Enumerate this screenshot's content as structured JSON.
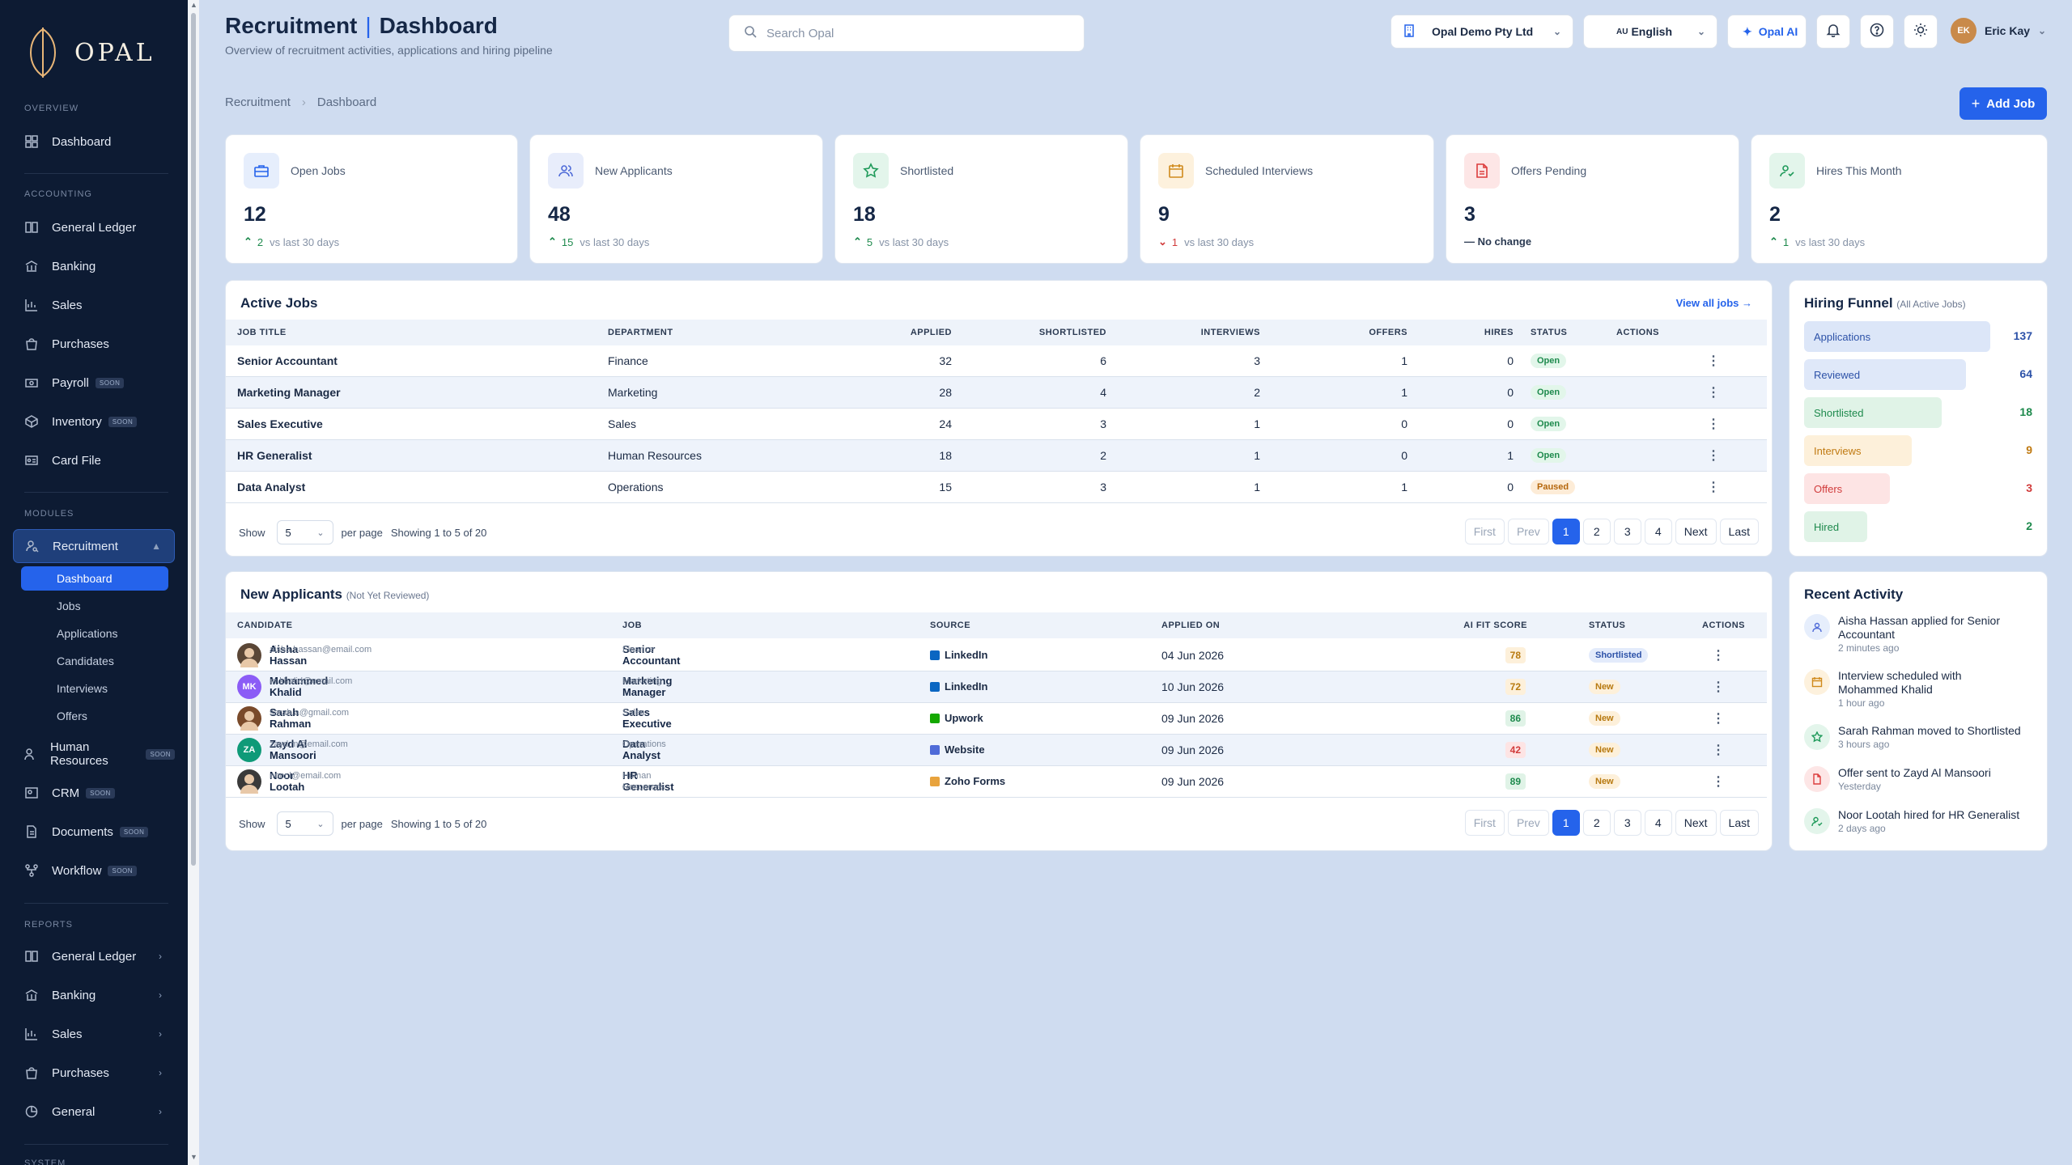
{
  "app": {
    "name": "OPAL"
  },
  "sidebar": {
    "overview_title": "OVERVIEW",
    "accounting_title": "ACCOUNTING",
    "modules_title": "MODULES",
    "reports_title": "REPORTS",
    "system_title": "SYSTEM",
    "soon": "SOON",
    "dashboard": "Dashboard",
    "accounting": [
      "General Ledger",
      "Banking",
      "Sales",
      "Purchases",
      "Payroll",
      "Inventory",
      "Card File"
    ],
    "recruitment": "Recruitment",
    "recruitment_sub": [
      "Dashboard",
      "Jobs",
      "Applications",
      "Candidates",
      "Interviews",
      "Offers"
    ],
    "modules": [
      "Human Resources",
      "CRM",
      "Documents",
      "Workflow"
    ],
    "reports": [
      "General Ledger",
      "Banking",
      "Sales",
      "Purchases",
      "General"
    ]
  },
  "header": {
    "title": "Recruitment",
    "title_sep": "|",
    "title_page": "Dashboard",
    "subtitle": "Overview of recruitment activities, applications and hiring pipeline",
    "search_placeholder": "Search Opal",
    "company": "Opal Demo Pty Ltd",
    "lang_code": "AU",
    "language": "English",
    "ai": "Opal AI",
    "user_initials": "EK",
    "user_name": "Eric Kay"
  },
  "breadcrumb": {
    "root": "Recruitment",
    "current": "Dashboard"
  },
  "add_job": "Add Job",
  "stats": [
    {
      "label": "Open Jobs",
      "value": "12",
      "delta": "2",
      "note": "vs last 30 days",
      "dir": "up",
      "color": "#2563eb",
      "bg": "#e6eefc"
    },
    {
      "label": "New Applicants",
      "value": "48",
      "delta": "15",
      "note": "vs last 30 days",
      "dir": "up",
      "color": "#4f6bd8",
      "bg": "#e8edfb"
    },
    {
      "label": "Shortlisted",
      "value": "18",
      "delta": "5",
      "note": "vs last 30 days",
      "dir": "up",
      "color": "#1f9a5a",
      "bg": "#e3f5eb"
    },
    {
      "label": "Scheduled Interviews",
      "value": "9",
      "delta": "1",
      "note": "vs last 30 days",
      "dir": "down",
      "color": "#d08a1c",
      "bg": "#fdf1dd"
    },
    {
      "label": "Offers Pending",
      "value": "3",
      "delta": "",
      "note": "— No change",
      "dir": "none",
      "color": "#dc3d3d",
      "bg": "#fde6e6"
    },
    {
      "label": "Hires This Month",
      "value": "2",
      "delta": "1",
      "note": "vs last 30 days",
      "dir": "up",
      "color": "#1f9a5a",
      "bg": "#e3f5eb"
    }
  ],
  "active_jobs": {
    "title": "Active Jobs",
    "view_all": "View all jobs →",
    "columns": [
      "JOB TITLE",
      "DEPARTMENT",
      "APPLIED",
      "SHORTLISTED",
      "INTERVIEWS",
      "OFFERS",
      "HIRES",
      "STATUS",
      "ACTIONS"
    ],
    "rows": [
      [
        "Senior Accountant",
        "Finance",
        "32",
        "6",
        "3",
        "1",
        "0",
        "Open"
      ],
      [
        "Marketing Manager",
        "Marketing",
        "28",
        "4",
        "2",
        "1",
        "0",
        "Open"
      ],
      [
        "Sales Executive",
        "Sales",
        "24",
        "3",
        "1",
        "0",
        "0",
        "Open"
      ],
      [
        "HR Generalist",
        "Human Resources",
        "18",
        "2",
        "1",
        "0",
        "1",
        "Open"
      ],
      [
        "Data Analyst",
        "Operations",
        "15",
        "3",
        "1",
        "1",
        "0",
        "Paused"
      ]
    ]
  },
  "pagination": {
    "show": "Show",
    "per_page_value": "5",
    "per_page": "per page",
    "showing": "Showing 1 to 5 of 20",
    "first": "First",
    "prev": "Prev",
    "pages": [
      "1",
      "2",
      "3",
      "4"
    ],
    "next": "Next",
    "last": "Last"
  },
  "funnel": {
    "title": "Hiring Funnel",
    "subtitle": "(All Active Jobs)",
    "stages": [
      {
        "label": "Applications",
        "value": "137",
        "fraction": 1.0,
        "bg": "#dce6f8",
        "color": "#2d52a8"
      },
      {
        "label": "Reviewed",
        "value": "64",
        "fraction": 0.87,
        "bg": "#dfe8f9",
        "color": "#2d52a8"
      },
      {
        "label": "Shortlisted",
        "value": "18",
        "fraction": 0.74,
        "bg": "#e0f3e7",
        "color": "#1e8a4d"
      },
      {
        "label": "Interviews",
        "value": "9",
        "fraction": 0.58,
        "bg": "#fdf0da",
        "color": "#c07a12"
      },
      {
        "label": "Offers",
        "value": "3",
        "fraction": 0.46,
        "bg": "#fde4e4",
        "color": "#d13b3b"
      },
      {
        "label": "Hired",
        "value": "2",
        "fraction": 0.34,
        "bg": "#e0f3e7",
        "color": "#1e8a4d"
      }
    ]
  },
  "new_applicants": {
    "title": "New Applicants",
    "subtitle": "(Not Yet Reviewed)",
    "columns": [
      "CANDIDATE",
      "JOB",
      "SOURCE",
      "APPLIED ON",
      "AI FIT SCORE",
      "STATUS",
      "ACTIONS"
    ],
    "rows": [
      {
        "name": "Aisha Hassan",
        "email": "aisha.hassan@email.com",
        "initials": "",
        "av": "#5a4636",
        "job": "Senior Accountant",
        "dept": "Finance",
        "source": "LinkedIn",
        "src_color": "#0a66c2",
        "date": "04 Jun 2026",
        "score": "78",
        "score_bg": "#fdf0da",
        "score_c": "#b7790f",
        "status": "Shortlisted",
        "st": "short"
      },
      {
        "name": "Mohammed Khalid",
        "email": "m.khalid@email.com",
        "initials": "MK",
        "av": "#8b5cf6",
        "job": "Marketing Manager",
        "dept": "Marketing",
        "source": "LinkedIn",
        "src_color": "#0a66c2",
        "date": "10 Jun 2026",
        "score": "72",
        "score_bg": "#fdf0da",
        "score_c": "#b7790f",
        "status": "New",
        "st": "new"
      },
      {
        "name": "Sarah Rahman",
        "email": "sarah.a@gmail.com",
        "initials": "",
        "av": "#7a4a2a",
        "job": "Sales Executive",
        "dept": "Sales",
        "source": "Upwork",
        "src_color": "#14a800",
        "date": "09 Jun 2026",
        "score": "86",
        "score_bg": "#e0f3e7",
        "score_c": "#1e8a4d",
        "status": "New",
        "st": "new"
      },
      {
        "name": "Zayd Al Mansoori",
        "email": "zayd.m@email.com",
        "initials": "ZA",
        "av": "#0f9a78",
        "job": "Data Analyst",
        "dept": "Operations",
        "source": "Website",
        "src_color": "#4f6bd8",
        "date": "09 Jun 2026",
        "score": "42",
        "score_bg": "#fde4e4",
        "score_c": "#d13b3b",
        "status": "New",
        "st": "new"
      },
      {
        "name": "Noor Lootah",
        "email": "noor.l@email.com",
        "initials": "",
        "av": "#3a3a3a",
        "job": "HR Generalist",
        "dept": "Human Resources",
        "source": "Zoho Forms",
        "src_color": "#e8a33d",
        "date": "09 Jun 2026",
        "score": "89",
        "score_bg": "#e0f3e7",
        "score_c": "#1e8a4d",
        "status": "New",
        "st": "new"
      }
    ]
  },
  "activity": {
    "title": "Recent Activity",
    "items": [
      {
        "text": "Aisha Hassan applied for Senior Accountant",
        "time": "2 minutes ago",
        "bg": "#e6eefc",
        "color": "#4f6bd8",
        "icon": "user-icon"
      },
      {
        "text": "Interview scheduled with Mohammed Khalid",
        "time": "1 hour ago",
        "bg": "#fdf1dd",
        "color": "#d08a1c",
        "icon": "calendar-icon"
      },
      {
        "text": "Sarah Rahman moved to Shortlisted",
        "time": "3 hours ago",
        "bg": "#e3f5eb",
        "color": "#1f9a5a",
        "icon": "star-icon"
      },
      {
        "text": "Offer sent to Zayd Al Mansoori",
        "time": "Yesterday",
        "bg": "#fde6e6",
        "color": "#dc3d3d",
        "icon": "document-icon"
      },
      {
        "text": "Noor Lootah hired for HR Generalist",
        "time": "2 days ago",
        "bg": "#e3f5eb",
        "color": "#1f9a5a",
        "icon": "user-check-icon"
      }
    ]
  }
}
